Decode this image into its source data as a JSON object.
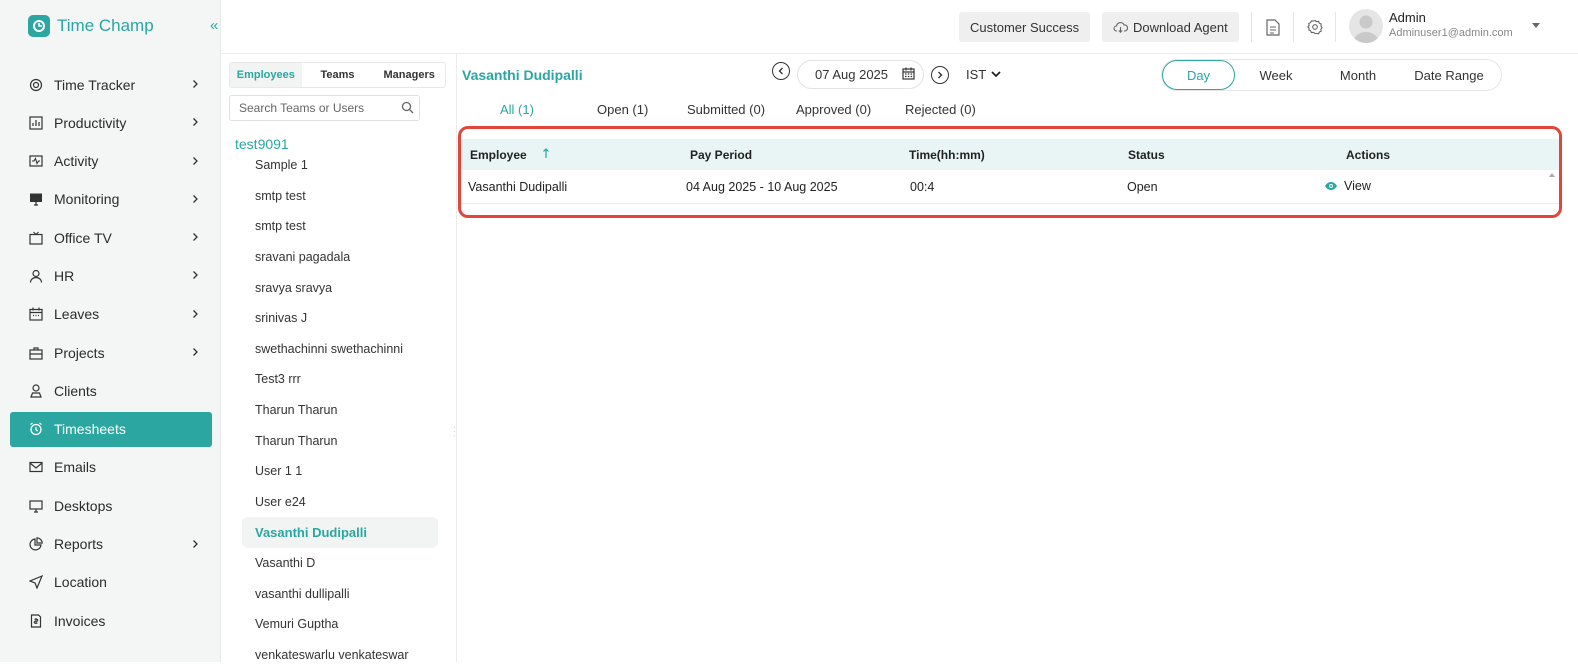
{
  "brand": {
    "name": "Time Champ"
  },
  "sidebar": {
    "items": [
      {
        "label": "Time Tracker",
        "icon": "time-tracker-icon",
        "chevron": true
      },
      {
        "label": "Productivity",
        "icon": "productivity-icon",
        "chevron": true
      },
      {
        "label": "Activity",
        "icon": "activity-icon",
        "chevron": true
      },
      {
        "label": "Monitoring",
        "icon": "monitor-icon",
        "chevron": true
      },
      {
        "label": "Office TV",
        "icon": "tv-icon",
        "chevron": true
      },
      {
        "label": "HR",
        "icon": "user-icon",
        "chevron": true
      },
      {
        "label": "Leaves",
        "icon": "calendar-icon",
        "chevron": true
      },
      {
        "label": "Projects",
        "icon": "briefcase-icon",
        "chevron": true
      },
      {
        "label": "Clients",
        "icon": "client-icon",
        "chevron": false
      },
      {
        "label": "Timesheets",
        "icon": "alarm-icon",
        "chevron": false,
        "active": true
      },
      {
        "label": "Emails",
        "icon": "mail-icon",
        "chevron": false
      },
      {
        "label": "Desktops",
        "icon": "desktop-icon",
        "chevron": false
      },
      {
        "label": "Reports",
        "icon": "pie-chart-icon",
        "chevron": true
      },
      {
        "label": "Location",
        "icon": "location-icon",
        "chevron": false
      },
      {
        "label": "Invoices",
        "icon": "invoice-icon",
        "chevron": false
      }
    ]
  },
  "topbar": {
    "customer_success": "Customer Success",
    "download_agent": "Download Agent",
    "user_name": "Admin",
    "user_email": "Adminuser1@admin.com"
  },
  "employees": {
    "tabs": [
      "Employees",
      "Teams",
      "Managers"
    ],
    "search_placeholder": "Search Teams or Users",
    "group": "test9091",
    "items": [
      "Sample 1",
      "smtp test",
      "smtp test",
      "sravani pagadala",
      "sravya sravya",
      "srinivas J",
      "swethachinni swethachinni",
      "Test3 rrr",
      "Tharun Tharun",
      "Tharun Tharun",
      "User 1 1",
      "User e24",
      "Vasanthi Dudipalli",
      "Vasanthi D",
      "vasanthi dullipalli",
      "Vemuri Guptha",
      "venkateswarlu venkateswar"
    ],
    "active_index": 12
  },
  "main": {
    "title": "Vasanthi Dudipalli",
    "date": "07 Aug 2025",
    "timezone": "IST",
    "ranges": [
      "Day",
      "Week",
      "Month",
      "Date Range"
    ],
    "status_tabs": [
      "All (1)",
      "Open (1)",
      "Submitted (0)",
      "Approved (0)",
      "Rejected (0)"
    ],
    "table": {
      "headers": [
        "Employee",
        "Pay Period",
        "Time(hh:mm)",
        "Status",
        "Actions"
      ],
      "rows": [
        {
          "employee": "Vasanthi Dudipalli",
          "pay_period": "04 Aug 2025 - 10 Aug 2025",
          "time": "00:4",
          "status": "Open",
          "action": "View"
        }
      ]
    }
  },
  "colors": {
    "accent": "#2ba6a1",
    "highlight_border": "#e0473a"
  }
}
